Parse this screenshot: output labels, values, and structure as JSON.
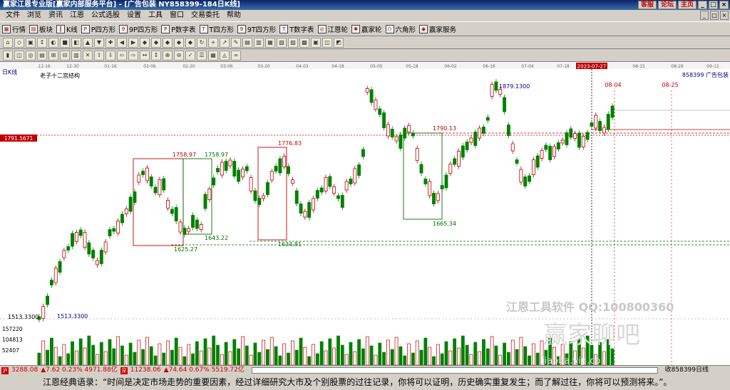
{
  "window": {
    "title": "赢家江恩专业版[赢家内部服务平台] - [广告包装  NY858399-184日K线]",
    "links": [
      "客服",
      "论坛",
      "主页"
    ],
    "win_buttons": [
      "_",
      "□",
      "×"
    ]
  },
  "menu": [
    "文件",
    "浏览",
    "资讯",
    "江恩",
    "公式选股",
    "设置",
    "工具",
    "窗口",
    "交易委托",
    "帮助"
  ],
  "toolbar": [
    "行情",
    "板块",
    "K线",
    "P四方形",
    "9P四方形",
    "P数字表",
    "T四方形",
    "9T四方形",
    "T数字表",
    "江恩轮",
    "赢家轮",
    "六角形",
    "赢家服务"
  ],
  "chart": {
    "period_label": "日K线",
    "study_title": "老子十二宫结构",
    "stock_label": "858399  广告包装",
    "crosshair_date": "2023-07-27",
    "left_price_box": "1791.5671",
    "low_label": "1513.3300",
    "dates": [
      "12-16",
      "12-30",
      "01-16",
      "02-06",
      "02-20",
      "03-06",
      "03-20",
      "04-03",
      "04-18",
      "05-05",
      "05-18",
      "06-02",
      "06-16",
      "07-04",
      "07-18",
      "08-03",
      "08-15",
      "08-29",
      "09-12"
    ],
    "future_dates": [
      "08-04",
      "08-25"
    ],
    "price_labels": [
      {
        "text": "1879.1300",
        "color": "#000080"
      },
      {
        "text": "1790.13",
        "color": "#c00000"
      },
      {
        "text": "1776.83",
        "color": "#c00000"
      },
      {
        "text": "1758.97",
        "color": "#c00000"
      },
      {
        "text": "1758.97",
        "color": "#007000"
      },
      {
        "text": "1665.34",
        "color": "#007000"
      },
      {
        "text": "1643.22",
        "color": "#007000"
      },
      {
        "text": "1634.81",
        "color": "#007000"
      },
      {
        "text": "1625.27",
        "color": "#007000"
      },
      {
        "text": "1513.3300",
        "color": "#000080"
      }
    ],
    "volume_labels": [
      "157220",
      "104813",
      "52407"
    ],
    "watermark1": "江恩工具软件  QQ:100800360",
    "watermark2": "赢家聊吧",
    "watermark3": "jiaoba.vip.co"
  },
  "status": {
    "index1": "3288.08",
    "chg1": "▲7.62  0.23%  4971.88亿",
    "index2": "11238.06",
    "chg2": "▲74.64  0.67%  5519.72亿",
    "right_label": "收858399日线"
  },
  "quote": "江恩经典语录：“时间是决定市场走势的重要因素，经过详细研究大市及个别股票的过往记录，你将可以证明，历史确实重复发生；而了解过往，你将可以预测将来。”。"
}
